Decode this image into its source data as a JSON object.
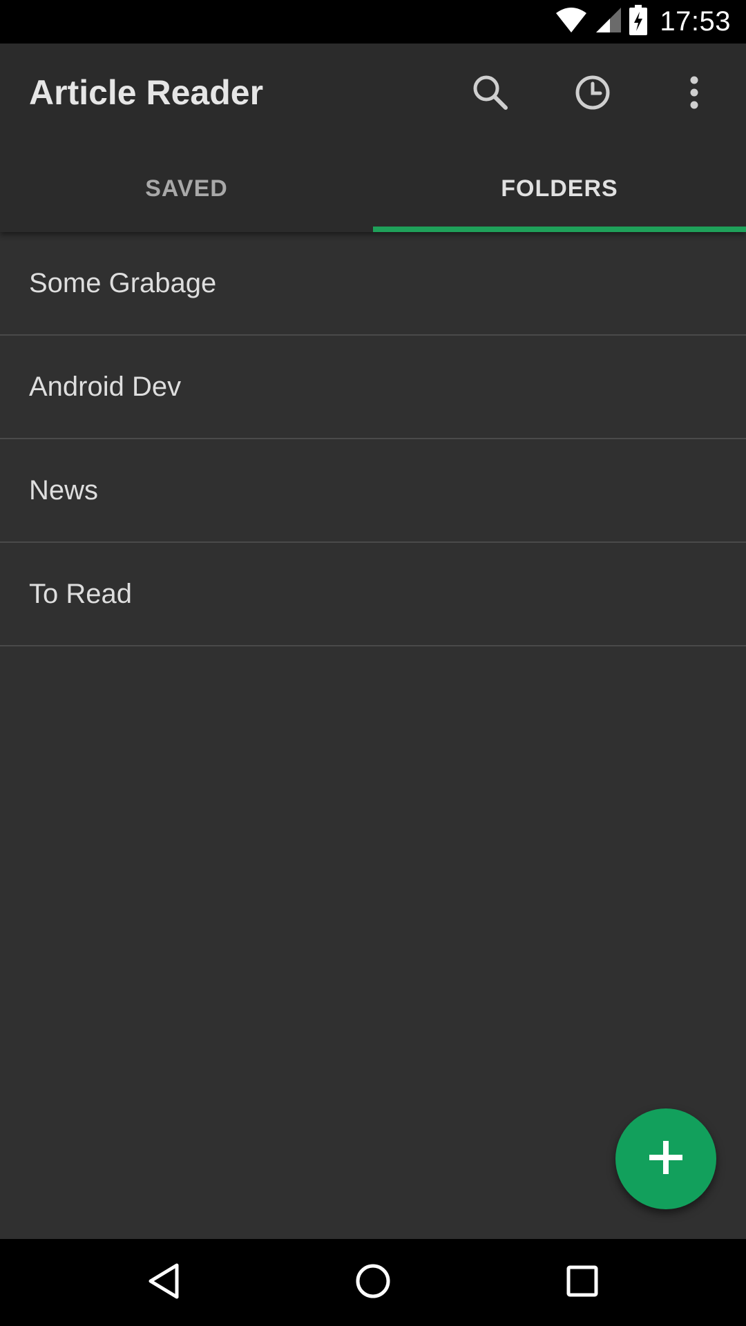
{
  "status_bar": {
    "time": "17:53",
    "icons": [
      "wifi-icon",
      "cell-signal-icon",
      "battery-charging-icon"
    ]
  },
  "toolbar": {
    "title": "Article Reader",
    "actions": [
      "search-icon",
      "history-clock-icon",
      "overflow-menu-icon"
    ]
  },
  "tabs": [
    {
      "label": "SAVED",
      "active": false
    },
    {
      "label": "FOLDERS",
      "active": true
    }
  ],
  "folders": [
    {
      "name": "Some Grabage"
    },
    {
      "name": "Android Dev"
    },
    {
      "name": "News"
    },
    {
      "name": "To Read"
    }
  ],
  "fab": {
    "icon": "plus-icon"
  },
  "nav_bar": {
    "icons": [
      "back-icon",
      "home-icon",
      "recents-icon"
    ]
  },
  "colors": {
    "accent": "#12a05c",
    "tab_indicator": "#1fa15a",
    "background": "#303030",
    "app_bar": "#2b2b2b"
  }
}
